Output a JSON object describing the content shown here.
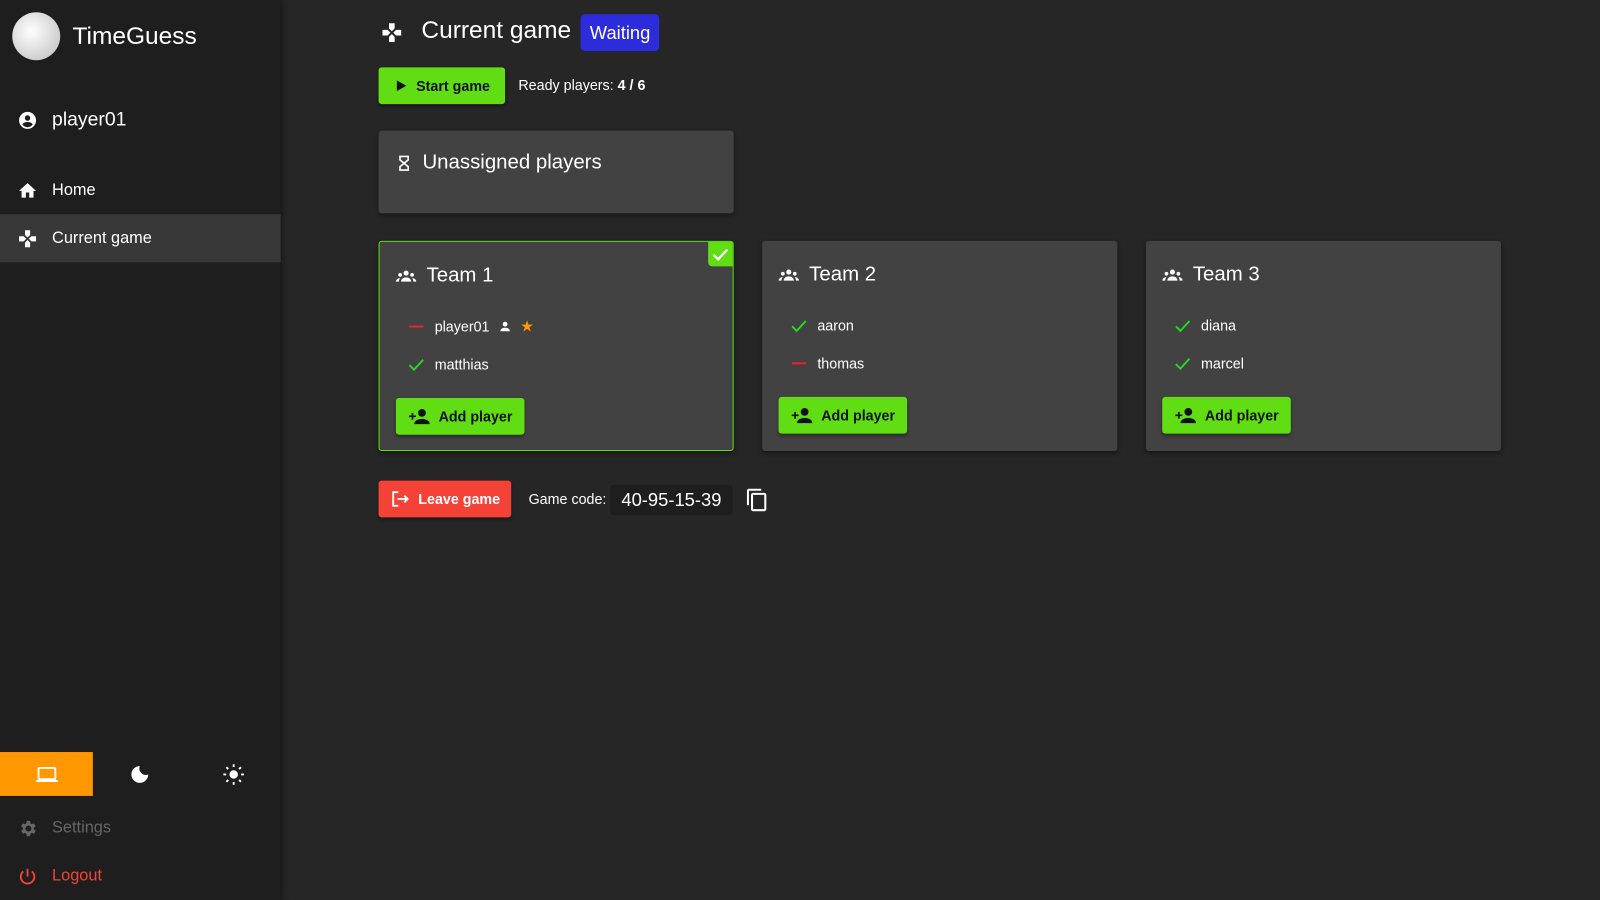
{
  "app": {
    "title": "TimeGuess"
  },
  "user": {
    "name": "player01"
  },
  "sidebar": {
    "items": [
      {
        "label": "Home",
        "icon": "home-icon"
      },
      {
        "label": "Current game",
        "icon": "gamepad-icon",
        "active": true
      }
    ],
    "themes": [
      {
        "name": "system",
        "icon": "laptop-icon",
        "active": true
      },
      {
        "name": "dark",
        "icon": "moon-icon"
      },
      {
        "name": "light",
        "icon": "sun-icon"
      }
    ],
    "settings": "Settings",
    "logout": "Logout"
  },
  "header": {
    "title": "Current game",
    "status": "Waiting"
  },
  "toolbar": {
    "start": "Start game",
    "ready_label": "Ready players:",
    "ready_value": "4 / 6"
  },
  "unassigned": {
    "title": "Unassigned players"
  },
  "teams": [
    {
      "name": "Team 1",
      "ready": true,
      "players": [
        {
          "name": "player01",
          "ready": false,
          "is_self": true,
          "is_host": true
        },
        {
          "name": "matthias",
          "ready": true
        }
      ],
      "add": "Add player"
    },
    {
      "name": "Team 2",
      "ready": false,
      "players": [
        {
          "name": "aaron",
          "ready": true
        },
        {
          "name": "thomas",
          "ready": false
        }
      ],
      "add": "Add player"
    },
    {
      "name": "Team 3",
      "ready": false,
      "players": [
        {
          "name": "diana",
          "ready": true
        },
        {
          "name": "marcel",
          "ready": true
        }
      ],
      "add": "Add player"
    }
  ],
  "footer": {
    "leave": "Leave game",
    "code_label": "Game code:",
    "code": "40-95-15-39"
  },
  "colors": {
    "accent": "#61dd14",
    "status": "#2c2cdc",
    "danger": "#f44336",
    "theme_active": "#ff9800"
  }
}
